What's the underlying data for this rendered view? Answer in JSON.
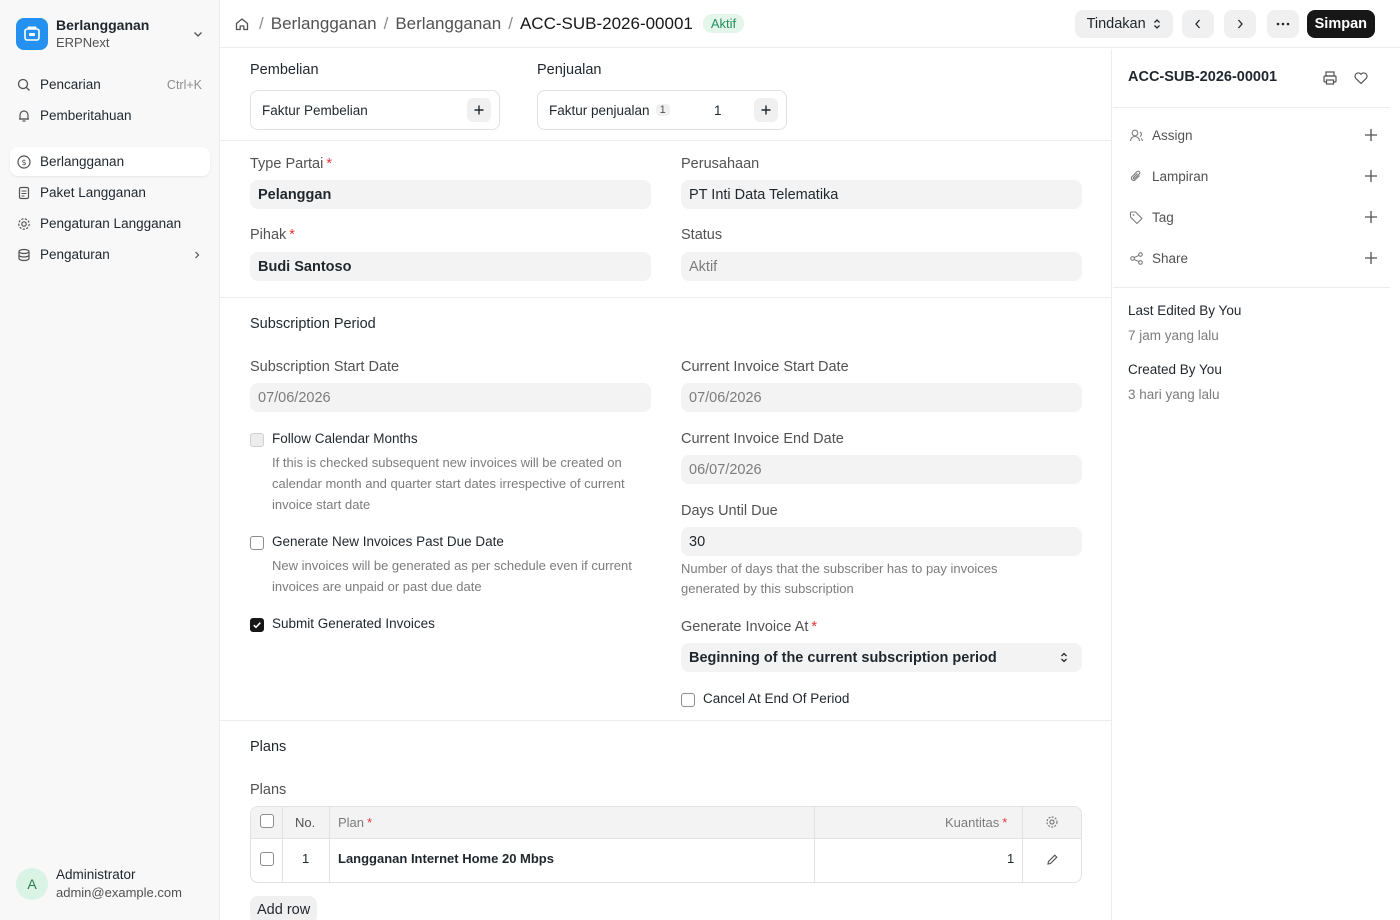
{
  "sidebar": {
    "app_name": "Berlangganan",
    "app_sub": "ERPNext",
    "search_label": "Pencarian",
    "search_shortcut": "Ctrl+K",
    "notifications_label": "Pemberitahuan",
    "items": [
      {
        "label": "Berlangganan",
        "icon": "dollar-circle-icon",
        "active": true
      },
      {
        "label": "Paket Langganan",
        "icon": "document-icon"
      },
      {
        "label": "Pengaturan Langganan",
        "icon": "gear-icon"
      },
      {
        "label": "Pengaturan",
        "icon": "database-icon"
      }
    ],
    "user": {
      "initial": "A",
      "name": "Administrator",
      "email": "admin@example.com"
    }
  },
  "header": {
    "breadcrumbs": [
      "Berlangganan",
      "Berlangganan",
      "ACC-SUB-2026-00001"
    ],
    "status_badge": "Aktif",
    "actions_label": "Tindakan",
    "save_label": "Simpan"
  },
  "form": {
    "purchase": {
      "section_label": "Pembelian",
      "link_label": "Faktur Pembelian"
    },
    "sales": {
      "section_label": "Penjualan",
      "link_label": "Faktur penjualan",
      "count_badge": "1",
      "count": "1"
    },
    "party_type": {
      "label": "Type Partai",
      "value": "Pelanggan"
    },
    "company": {
      "label": "Perusahaan",
      "value": "PT Inti Data Telematika"
    },
    "party": {
      "label": "Pihak",
      "value": "Budi Santoso"
    },
    "status": {
      "label": "Status",
      "value": "Aktif"
    },
    "period_section": "Subscription Period",
    "start_date": {
      "label": "Subscription Start Date",
      "value": "07/06/2026"
    },
    "invoice_start": {
      "label": "Current Invoice Start Date",
      "value": "07/06/2026"
    },
    "invoice_end": {
      "label": "Current Invoice End Date",
      "value": "06/07/2026"
    },
    "follow_calendar": {
      "label": "Follow Calendar Months",
      "checked": false,
      "description": "If this is checked subsequent new invoices will be created on calendar month and quarter start dates irrespective of current invoice start date"
    },
    "generate_past_due": {
      "label": "Generate New Invoices Past Due Date",
      "checked": false,
      "description": "New invoices will be generated as per schedule even if current invoices are unpaid or past due date"
    },
    "submit_generated": {
      "label": "Submit Generated Invoices",
      "checked": true
    },
    "days_until_due": {
      "label": "Days Until Due",
      "value": "30",
      "description": "Number of days that the subscriber has to pay invoices generated by this subscription"
    },
    "generate_at": {
      "label": "Generate Invoice At",
      "value": "Beginning of the current subscription period"
    },
    "cancel_at_end": {
      "label": "Cancel At End Of Period",
      "checked": false
    },
    "plans_section": "Plans",
    "plans_label": "Plans",
    "plans_table": {
      "columns": {
        "no": "No.",
        "plan": "Plan",
        "qty": "Kuantitas"
      },
      "rows": [
        {
          "no": "1",
          "plan": "Langganan Internet Home 20 Mbps",
          "qty": "1"
        }
      ]
    },
    "add_row_label": "Add row"
  },
  "right_panel": {
    "doc_title": "ACC-SUB-2026-00001",
    "items": [
      {
        "label": "Assign",
        "icon": "user-icon"
      },
      {
        "label": "Lampiran",
        "icon": "paperclip-icon"
      },
      {
        "label": "Tag",
        "icon": "tag-icon"
      },
      {
        "label": "Share",
        "icon": "share-icon"
      }
    ],
    "last_edited_label": "Last Edited By You",
    "last_edited_time": "7 jam yang lalu",
    "created_label": "Created By You",
    "created_time": "3 hari yang lalu"
  },
  "colors": {
    "accent": "#2490ef",
    "status_green": "#278f5e",
    "required": "#e03636",
    "primary_button": "#171717"
  }
}
